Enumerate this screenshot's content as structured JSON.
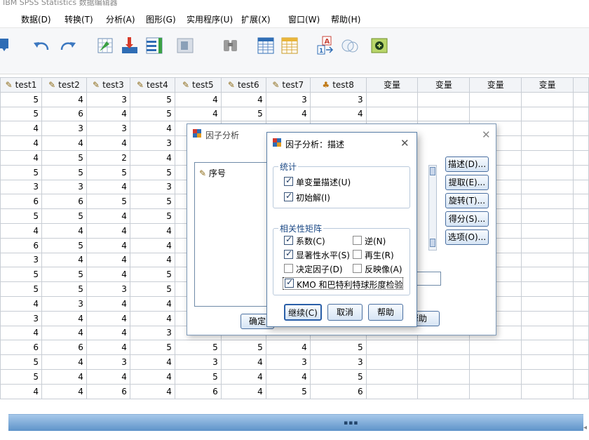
{
  "window": {
    "title": "IBM SPSS Statistics 数据编辑器"
  },
  "menubar": [
    "数据(D)",
    "转换(T)",
    "分析(A)",
    "图形(G)",
    "实用程序(U)",
    "扩展(X)",
    "窗口(W)",
    "帮助(H)"
  ],
  "toolbar_icons": [
    "save-icon",
    "undo-icon",
    "redo-icon",
    "goto-case-icon",
    "goto-variable-icon",
    "variables-icon",
    "run-descriptive-icon",
    "find-icon",
    "insert-cases-icon",
    "insert-variable-icon",
    "split-file-icon",
    "value-labels-icon",
    "use-sets-icon"
  ],
  "grid": {
    "columns": [
      {
        "name": "test1",
        "icon": "scale"
      },
      {
        "name": "test2",
        "icon": "scale"
      },
      {
        "name": "test3",
        "icon": "scale"
      },
      {
        "name": "test4",
        "icon": "scale"
      },
      {
        "name": "test5",
        "icon": "scale"
      },
      {
        "name": "test6",
        "icon": "scale"
      },
      {
        "name": "test7",
        "icon": "scale"
      },
      {
        "name": "test8",
        "icon": "nominal"
      },
      {
        "name": "变量",
        "icon": ""
      },
      {
        "name": "变量",
        "icon": ""
      },
      {
        "name": "变量",
        "icon": ""
      },
      {
        "name": "变量",
        "icon": ""
      }
    ],
    "rows": [
      [
        "5",
        "4",
        "3",
        "5",
        "4",
        "4",
        "3",
        "3"
      ],
      [
        "5",
        "6",
        "4",
        "5",
        "4",
        "5",
        "4",
        "4"
      ],
      [
        "4",
        "3",
        "3",
        "4",
        "",
        "",
        "",
        ""
      ],
      [
        "4",
        "4",
        "4",
        "3",
        "",
        "",
        "",
        ""
      ],
      [
        "4",
        "5",
        "2",
        "4",
        "",
        "",
        "",
        ""
      ],
      [
        "5",
        "5",
        "5",
        "5",
        "",
        "",
        "",
        ""
      ],
      [
        "3",
        "3",
        "4",
        "3",
        "",
        "",
        "",
        ""
      ],
      [
        "6",
        "6",
        "5",
        "5",
        "",
        "",
        "",
        ""
      ],
      [
        "5",
        "5",
        "4",
        "5",
        "",
        "",
        "",
        ""
      ],
      [
        "4",
        "4",
        "4",
        "4",
        "",
        "",
        "",
        ""
      ],
      [
        "6",
        "5",
        "4",
        "4",
        "",
        "",
        "",
        ""
      ],
      [
        "3",
        "4",
        "4",
        "4",
        "",
        "",
        "",
        ""
      ],
      [
        "5",
        "5",
        "4",
        "5",
        "",
        "",
        "",
        ""
      ],
      [
        "5",
        "5",
        "3",
        "5",
        "",
        "",
        "",
        ""
      ],
      [
        "4",
        "3",
        "4",
        "4",
        "",
        "",
        "",
        ""
      ],
      [
        "3",
        "4",
        "4",
        "4",
        "",
        "",
        "",
        ""
      ],
      [
        "4",
        "4",
        "4",
        "3",
        "5",
        "4",
        "4",
        "5"
      ],
      [
        "6",
        "6",
        "4",
        "5",
        "5",
        "5",
        "4",
        "5"
      ],
      [
        "5",
        "4",
        "3",
        "4",
        "3",
        "4",
        "3",
        "3"
      ],
      [
        "5",
        "4",
        "4",
        "4",
        "5",
        "4",
        "4",
        "5"
      ],
      [
        "4",
        "4",
        "6",
        "4",
        "6",
        "4",
        "5",
        "6"
      ]
    ]
  },
  "main_dialog": {
    "title": "因子分析",
    "source_list": [
      "序号"
    ],
    "side_buttons": [
      "描述(D)...",
      "提取(E)...",
      "旋转(T)...",
      "得分(S)...",
      "选项(O)..."
    ],
    "bottom_buttons": [
      "确定",
      "帮助"
    ]
  },
  "sub_dialog": {
    "title": "因子分析：描述",
    "statistics": {
      "label": "统计",
      "items": [
        "单变量描述(U)",
        "初始解(I)"
      ],
      "checked": [
        true,
        true
      ]
    },
    "correlation_matrix": {
      "label": "相关性矩阵",
      "items": [
        "系数(C)",
        "逆(N)",
        "显著性水平(S)",
        "再生(R)",
        "决定因子(D)",
        "反映像(A)",
        "KMO 和巴特利特球形度检验"
      ],
      "checked": [
        true,
        false,
        true,
        false,
        false,
        false,
        true
      ]
    },
    "buttons": [
      "继续(C)",
      "取消",
      "帮助"
    ]
  },
  "colors": {
    "dialog_border": "#7d99b8",
    "button_border": "#4a6fa0",
    "group_label": "#1c4a86",
    "scrollbar": "#5e93c9"
  }
}
